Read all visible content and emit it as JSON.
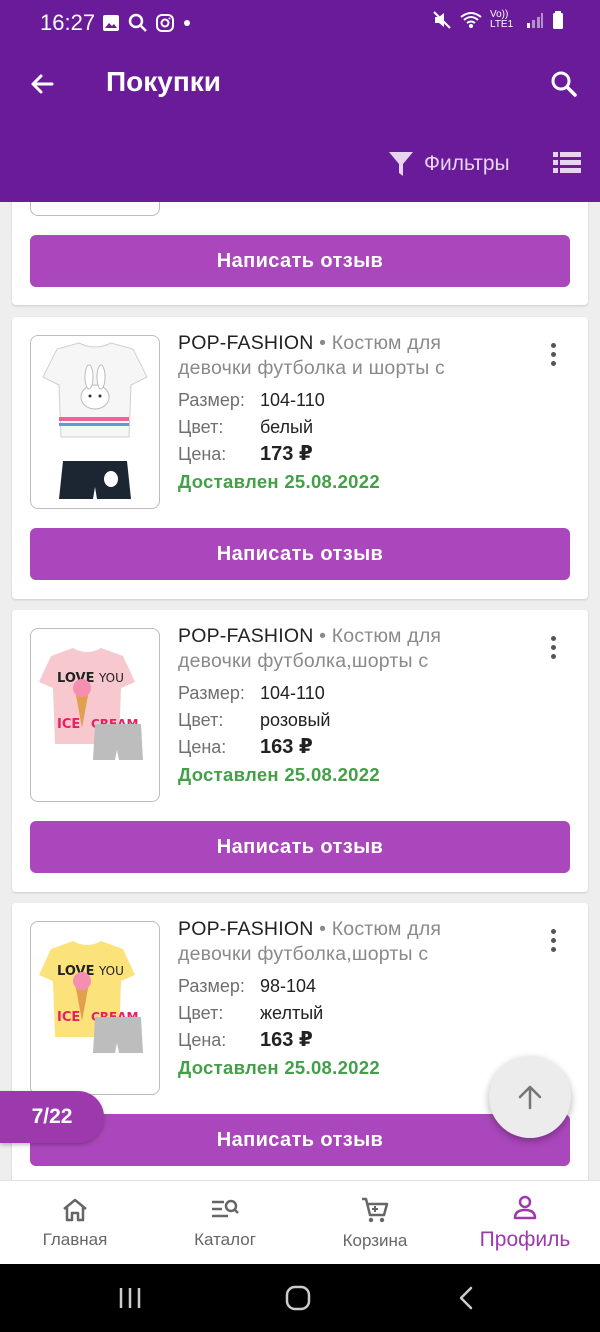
{
  "status_bar": {
    "time": "16:27",
    "network": "Vo)) LTE1"
  },
  "app_bar": {
    "title": "Покупки",
    "filters_label": "Фильтры"
  },
  "cards": [
    {
      "brand": "POP-FASHION",
      "title": "Костюм для девочки футболка и шорты с",
      "size_label": "Размер:",
      "size": "104-110",
      "color_label": "Цвет:",
      "color": "белый",
      "price_label": "Цена:",
      "price": "173 ₽",
      "status": "Доставлен 25.08.2022",
      "review_label": "Написать отзыв"
    },
    {
      "brand": "POP-FASHION",
      "title": "Костюм для девочки футболка,шорты с",
      "size_label": "Размер:",
      "size": "104-110",
      "color_label": "Цвет:",
      "color": "розовый",
      "price_label": "Цена:",
      "price": "163 ₽",
      "status": "Доставлен 25.08.2022",
      "review_label": "Написать отзыв"
    },
    {
      "brand": "POP-FASHION",
      "title": "Костюм для девочки футболка,шорты с",
      "size_label": "Размер:",
      "size": "98-104",
      "color_label": "Цвет:",
      "color": "желтый",
      "price_label": "Цена:",
      "price": "163 ₽",
      "status": "Доставлен 25.08.2022",
      "review_label": "Написать отзыв"
    }
  ],
  "partial_card": {
    "review_label": "Написать отзыв"
  },
  "last_card": {
    "review_label": "Написать отзыв"
  },
  "counter": "7/22",
  "bottom_nav": [
    {
      "label": "Главная",
      "icon": "home-icon"
    },
    {
      "label": "Каталог",
      "icon": "catalog-search-icon"
    },
    {
      "label": "Корзина",
      "icon": "cart-icon"
    },
    {
      "label": "Профиль",
      "icon": "profile-icon",
      "active": true
    }
  ],
  "colors": {
    "primary": "#6a1b9a",
    "accent": "#ab47bc",
    "success": "#43a047"
  }
}
